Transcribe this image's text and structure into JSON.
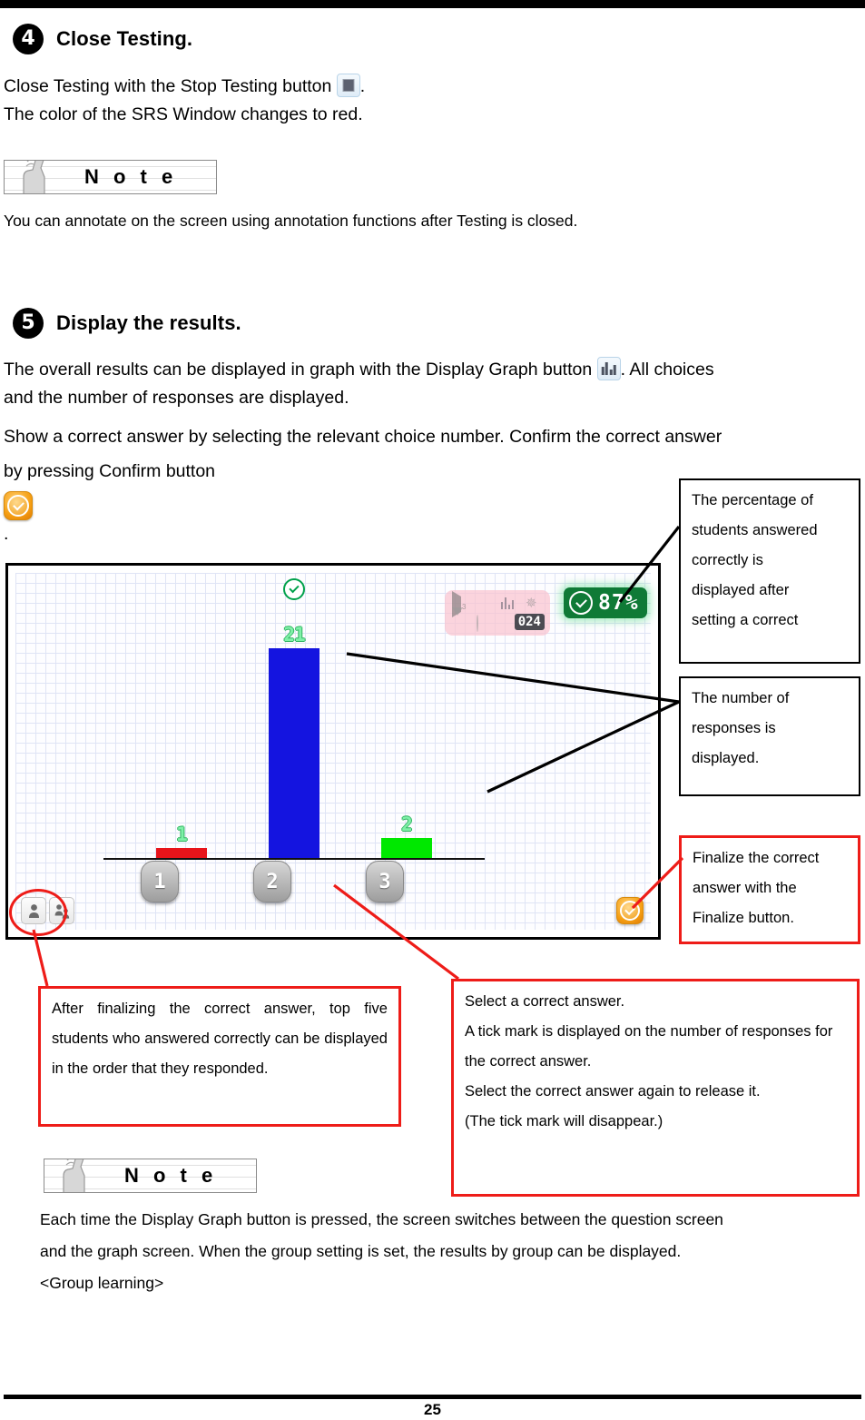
{
  "page": {
    "number": "25"
  },
  "steps": [
    {
      "num": "4",
      "title": "Close Testing.",
      "lines": [
        "Close Testing with the Stop Testing button",
        "The color of the SRS Window changes to red."
      ],
      "icon_name": "stop-testing-button-icon"
    },
    {
      "num": "5",
      "title": "Display the results.",
      "para1_a": "The overall results can be displayed in graph with the Display Graph button",
      "para1_b": ". All choices",
      "para1_c": "and the number of responses are displayed.",
      "para2_a": "Show a correct answer by selecting the relevant choice number. Confirm the correct answer",
      "para2_b": "by pressing Confirm button",
      "para2_c": "."
    }
  ],
  "note1": {
    "label": "N o t e",
    "body": "You can annotate on the screen using annotation functions after Testing is closed."
  },
  "note2": {
    "label": "N o t e",
    "line1": "Each time the Display Graph button is pressed, the screen switches between the question screen",
    "line2": "and the graph screen. When the group setting is set, the results by group can be displayed.",
    "line3": "<Group learning>"
  },
  "screenshot": {
    "percent_badge": "87%",
    "counter": "024",
    "toolbar": {
      "play_sub": "3",
      "icons_row1": [
        "play-icon",
        "stop-icon",
        "bar-chart-icon",
        "sparkle-icon"
      ],
      "icons_row2": [
        "triangle-down-icon",
        "timer-icon"
      ]
    },
    "bottom_left_icons": [
      "person-icon",
      "people-icon"
    ],
    "finalize_button_name": "finalize-button"
  },
  "chart_data": {
    "type": "bar",
    "title": "",
    "categories": [
      "1",
      "2",
      "3"
    ],
    "values": [
      1,
      21,
      2
    ],
    "value_labels": [
      "1",
      "21",
      "2"
    ],
    "colors": [
      "#e8141a",
      "#1414e0",
      "#00e800"
    ],
    "correct_answer": "2",
    "correct_answer_tick": true,
    "xlabel": "",
    "ylabel": "",
    "ylim": [
      0,
      24
    ],
    "grid": true,
    "legend": "none",
    "percent_correct": "87%",
    "total_responses": "024"
  },
  "callouts": [
    {
      "id": "percent-callout",
      "style": "black",
      "lines": [
        "The percentage of",
        "students answered",
        "correctly is",
        "displayed after",
        "setting a correct"
      ]
    },
    {
      "id": "responses-callout",
      "style": "black",
      "lines": [
        "The number of",
        "responses is",
        "displayed."
      ]
    },
    {
      "id": "finalize-callout",
      "style": "red",
      "lines": [
        "Finalize the correct",
        "answer with the",
        "Finalize button."
      ]
    },
    {
      "id": "top-five-callout",
      "style": "red",
      "text": "After finalizing the correct answer, top five students who answered correctly can be displayed in the order that they responded."
    },
    {
      "id": "select-answer-callout",
      "style": "red",
      "lines": [
        "Select a correct answer.",
        "A tick mark is displayed on the number of responses for the correct answer.",
        "Select the correct answer again to release it.",
        "(The tick mark will disappear.)"
      ]
    }
  ],
  "colors": {
    "accent_red": "#ee1c18",
    "bar_blue": "#1414e0",
    "bar_green": "#00e800",
    "bar_red": "#e8141a",
    "badge_green": "#0f7a36",
    "value_green": "#7ff0a8",
    "toolbar_pink": "#f9c4d0",
    "finalize_orange": "#f59e12"
  }
}
